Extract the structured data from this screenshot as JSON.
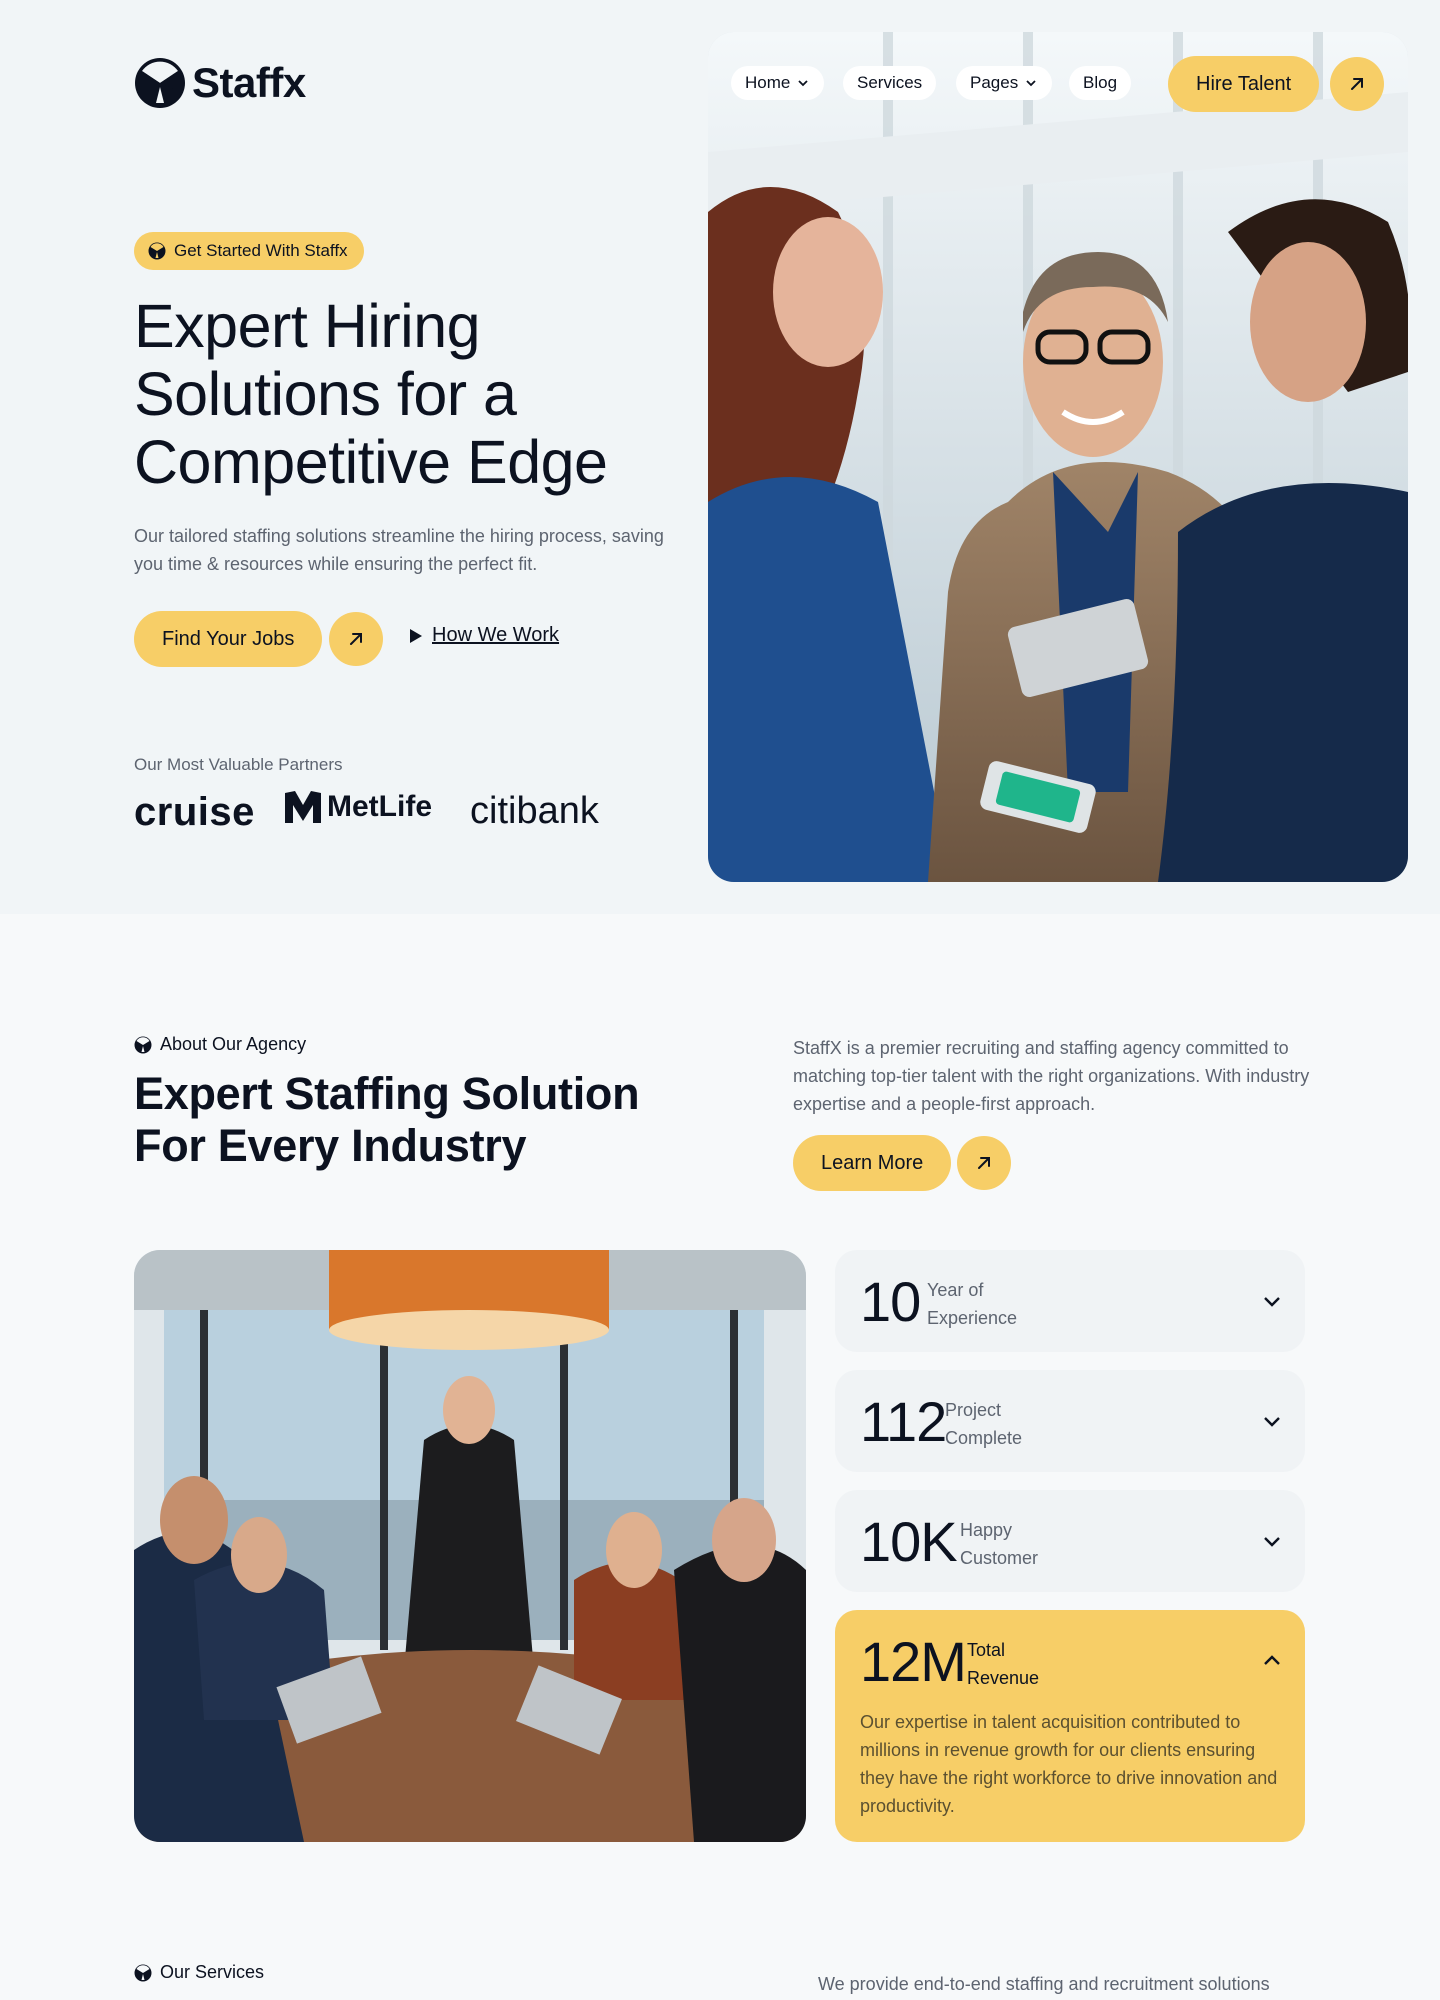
{
  "brand": {
    "name": "Staffx"
  },
  "nav": {
    "items": [
      {
        "label": "Home",
        "has_dropdown": true
      },
      {
        "label": "Services",
        "has_dropdown": false
      },
      {
        "label": "Pages",
        "has_dropdown": true
      },
      {
        "label": "Blog",
        "has_dropdown": false
      }
    ],
    "cta_label": "Hire Talent"
  },
  "hero": {
    "badge": "Get Started With Staffx",
    "title": "Expert Hiring Solutions for a Competitive Edge",
    "description": "Our tailored staffing solutions streamline the hiring process, saving you time & resources while ensuring the perfect fit.",
    "primary_cta": "Find Your Jobs",
    "secondary_cta": "How We Work",
    "partners_label": "Our Most Valuable Partners",
    "partners": [
      "cruise",
      "MetLife",
      "citibank"
    ]
  },
  "about": {
    "tag": "About Our Agency",
    "title": "Expert Staffing Solution For Every Industry",
    "description": "StaffX is a premier recruiting and staffing agency committed to matching top-tier talent with the right organizations. With industry expertise and a people-first approach.",
    "cta": "Learn More",
    "stats": [
      {
        "value": "10",
        "label": "Year of Experience",
        "expanded": false
      },
      {
        "value": "112",
        "label": "Project Complete",
        "expanded": false
      },
      {
        "value": "10K",
        "label": "Happy Customer",
        "expanded": false
      },
      {
        "value": "12M",
        "label": "Total Revenue",
        "expanded": true,
        "body": "Our expertise in talent acquisition  contributed to millions in revenue growth for our clients ensuring they have the right workforce to drive innovation and productivity."
      }
    ]
  },
  "services": {
    "tag": "Our Services",
    "description": "We provide end-to-end staffing and recruitment solutions"
  },
  "colors": {
    "accent": "#f7ce67",
    "text": "#0c1220",
    "muted": "#5d6470",
    "background": "#f7f9fa"
  }
}
